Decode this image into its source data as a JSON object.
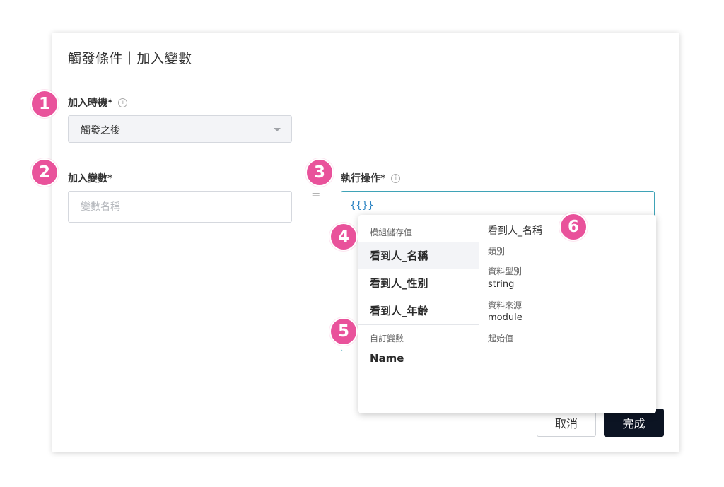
{
  "dialog": {
    "title": "觸發條件｜加入變數"
  },
  "timing": {
    "label": "加入時機*",
    "selected": "觸發之後"
  },
  "variable": {
    "label": "加入變數*",
    "placeholder": "變數名稱"
  },
  "operator": "=",
  "action": {
    "label": "執行操作*",
    "value": "{{}}"
  },
  "dropdown": {
    "groups": [
      {
        "label": "模組儲存值",
        "items": [
          "看到人_名稱",
          "看到人_性別",
          "看到人_年齡"
        ]
      },
      {
        "label": "自訂變數",
        "items": [
          "Name"
        ]
      }
    ],
    "detail": {
      "name": "看到人_名稱",
      "category_label": "類別",
      "type_label": "資料型別",
      "type_value": "string",
      "source_label": "資料來源",
      "source_value": "module",
      "initial_label": "起始值"
    }
  },
  "buttons": {
    "cancel": "取消",
    "done": "完成"
  },
  "markers": [
    "1",
    "2",
    "3",
    "4",
    "5",
    "6"
  ],
  "colors": {
    "marker": "#e9529b",
    "primary_button": "#0c1423",
    "focus_border": "#3fa3b7",
    "expression_text": "#2a82c2"
  }
}
